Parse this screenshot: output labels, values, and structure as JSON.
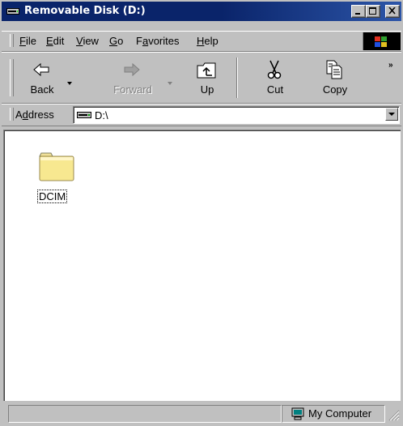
{
  "window": {
    "title": "Removable Disk (D:)",
    "title_bar_color": "#0a246a",
    "face_color": "#c0c0c0"
  },
  "menu": {
    "items": [
      {
        "label": "File",
        "access_key": "F",
        "rest": "ile"
      },
      {
        "label": "Edit",
        "access_key": "E",
        "rest": "dit"
      },
      {
        "label": "View",
        "access_key": "V",
        "rest": "iew"
      },
      {
        "label": "Go",
        "access_key": "G",
        "rest": "o"
      },
      {
        "label": "Favorites",
        "pre": "F",
        "access_key": "a",
        "rest": "vorites"
      },
      {
        "label": "Help",
        "access_key": "H",
        "rest": "elp"
      }
    ]
  },
  "toolbar": {
    "back_label": "Back",
    "forward_label": "Forward",
    "up_label": "Up",
    "cut_label": "Cut",
    "copy_label": "Copy",
    "more_glyph": "»"
  },
  "address": {
    "label_pre": "A",
    "label_key": "d",
    "label_rest": "dress",
    "value": "D:\\"
  },
  "content": {
    "items": [
      {
        "name": "DCIM",
        "type": "folder",
        "icon": "folder-icon",
        "selected_focus": true
      }
    ]
  },
  "status": {
    "left_text": "",
    "zone_label": "My Computer",
    "zone_icon": "computer-icon"
  }
}
